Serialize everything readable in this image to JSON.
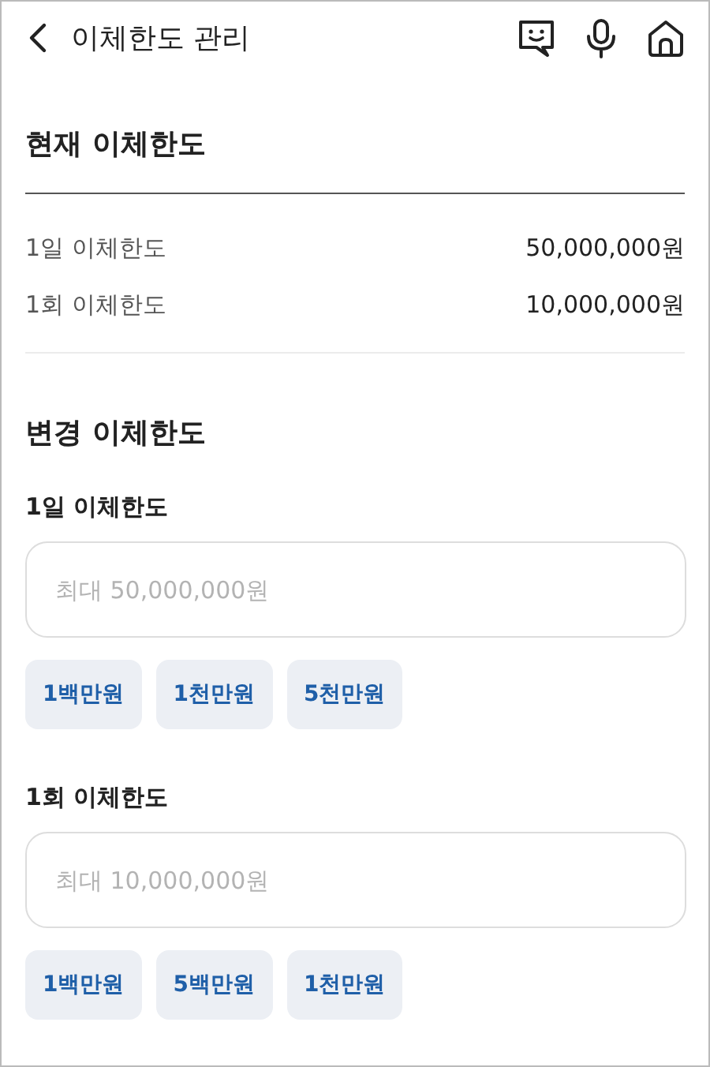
{
  "header": {
    "title": "이체한도 관리"
  },
  "current": {
    "title": "현재 이체한도",
    "rows": [
      {
        "label": "1일 이체한도",
        "value": "50,000,000원"
      },
      {
        "label": "1회 이체한도",
        "value": "10,000,000원"
      }
    ]
  },
  "change": {
    "title": "변경 이체한도",
    "fields": [
      {
        "label": "1일 이체한도",
        "placeholder": "최대 50,000,000원",
        "chips": [
          "1백만원",
          "1천만원",
          "5천만원"
        ]
      },
      {
        "label": "1회 이체한도",
        "placeholder": "최대 10,000,000원",
        "chips": [
          "1백만원",
          "5백만원",
          "1천만원"
        ]
      }
    ]
  }
}
